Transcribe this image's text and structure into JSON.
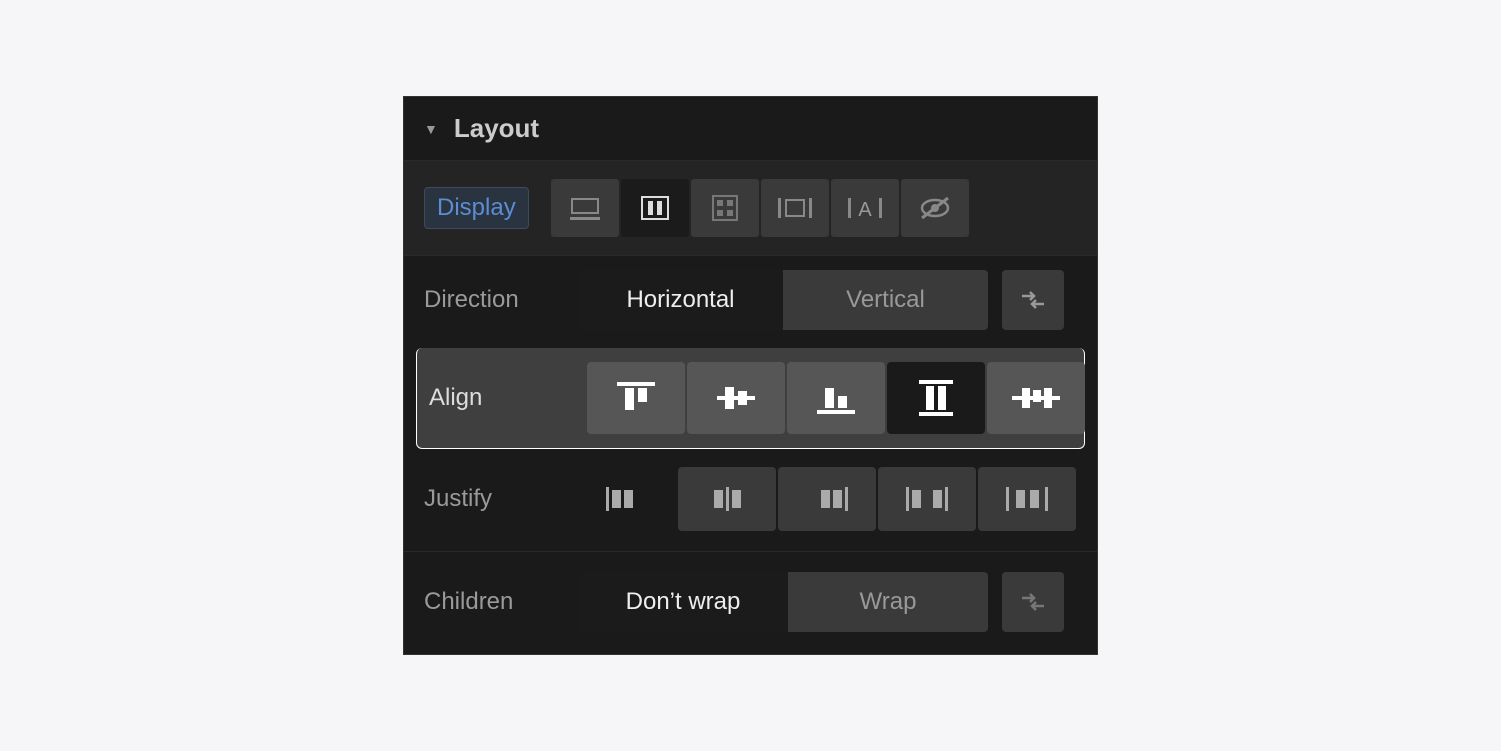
{
  "header": {
    "title": "Layout"
  },
  "display": {
    "label": "Display",
    "options": [
      "block",
      "flex",
      "grid",
      "inline-block",
      "inline",
      "none"
    ],
    "selected": "flex"
  },
  "direction": {
    "label": "Direction",
    "options": {
      "a": "Horizontal",
      "b": "Vertical"
    },
    "selected": "Horizontal",
    "reverse_button": "reverse"
  },
  "align": {
    "label": "Align",
    "options": [
      "flex-start",
      "center",
      "flex-end",
      "stretch",
      "baseline"
    ],
    "selected": "stretch"
  },
  "justify": {
    "label": "Justify",
    "options": [
      "flex-start",
      "center",
      "flex-end",
      "space-between",
      "space-around"
    ],
    "selected": "flex-start"
  },
  "children": {
    "label": "Children",
    "options": {
      "a": "Don’t wrap",
      "b": "Wrap"
    },
    "selected": "Don’t wrap",
    "reverse_button": "reverse-wrap"
  }
}
